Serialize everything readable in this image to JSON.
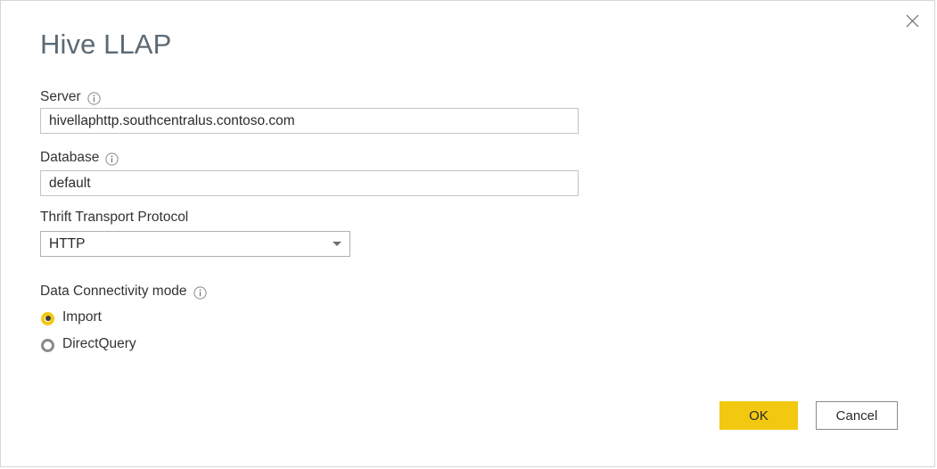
{
  "dialog": {
    "title": "Hive LLAP",
    "close_icon": "close-icon"
  },
  "fields": {
    "server": {
      "label": "Server",
      "info_icon": "info-icon",
      "value": "hivellaphttp.southcentralus.contoso.com",
      "placeholder": ""
    },
    "database": {
      "label": "Database",
      "info_icon": "info-icon",
      "value": "default",
      "placeholder": ""
    },
    "thrift_transport_protocol": {
      "label": "Thrift Transport Protocol",
      "value": "HTTP",
      "options": [
        "HTTP"
      ],
      "caret_icon": "chevron-down-icon"
    },
    "data_connectivity_mode": {
      "label": "Data Connectivity mode",
      "info_icon": "info-icon",
      "selected": "Import",
      "options": [
        {
          "label": "Import",
          "checked": true
        },
        {
          "label": "DirectQuery",
          "checked": false
        }
      ]
    }
  },
  "footer": {
    "ok_label": "OK",
    "cancel_label": "Cancel"
  },
  "colors": {
    "accent": "#f2c811",
    "title_text": "#5b6a75",
    "body_text": "#333333",
    "input_border": "#c4c4c4",
    "control_border": "#8a8a8a",
    "dialog_border": "#d6d6d6"
  }
}
